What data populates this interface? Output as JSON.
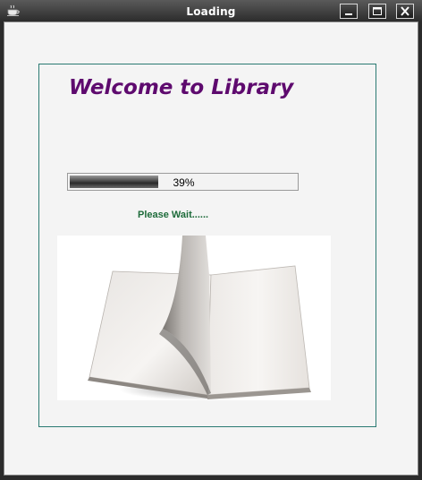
{
  "window": {
    "title": "Loading"
  },
  "welcome": {
    "text": "Welcome to Library"
  },
  "progress": {
    "value": 0.39,
    "label": "39%"
  },
  "status": {
    "text": "Please Wait......"
  },
  "icons": {
    "app": "coffee-cup-icon",
    "minimize": "minimize-icon",
    "maximize": "maximize-icon",
    "close": "close-icon",
    "book": "open-book-image"
  }
}
